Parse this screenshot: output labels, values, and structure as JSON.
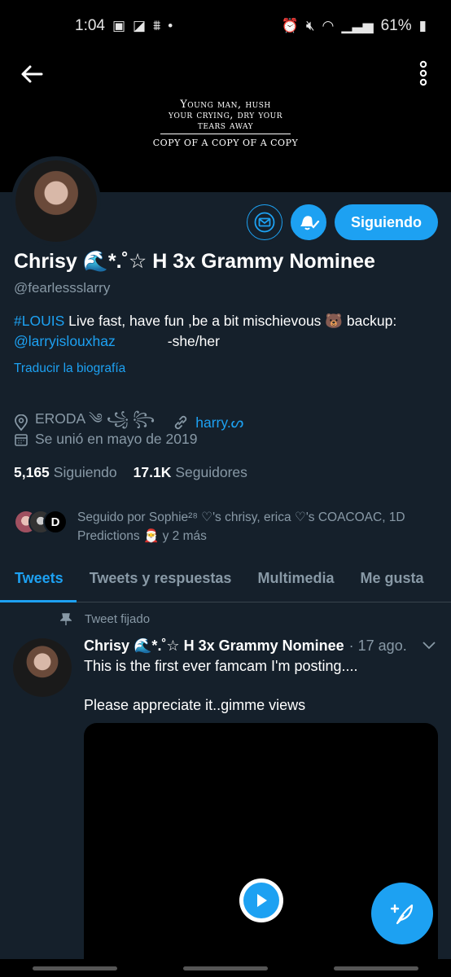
{
  "status_bar": {
    "time": "1:04",
    "battery": "61%"
  },
  "banner": {
    "lines": [
      "Young man, hush",
      "your crying, dry your",
      "tears away"
    ],
    "tagline": "COPY OF A COPY OF A COPY"
  },
  "profile": {
    "name": "Chrisy 🌊*.˚☆ H 3x Grammy Nominee",
    "handle": "@fearlessslarry",
    "bio_hashtag": "#LOUIS",
    "bio_text": " Live fast, have fun ,be a bit mischievous 🐻   backup:",
    "bio_mention": "@larryislouxhaz",
    "bio_pronouns": "-she/her",
    "translate": "Traducir la biografía",
    "location": "ERODA ༄ ꧁  ꧂",
    "link": "harry.ᔕ",
    "joined": "Se unió en mayo de 2019",
    "following_count": "5,165",
    "following_label": "Siguiendo",
    "followers_count": "17.1K",
    "followers_label": "Seguidores",
    "followed_by": "Seguido por Sophie²⁸ ♡'s chrisy, erica ♡'s COACOAC, 1D Predictions 🎅 y 2 más",
    "follow_button": "Siguiendo"
  },
  "tabs": [
    "Tweets",
    "Tweets y respuestas",
    "Multimedia",
    "Me gusta"
  ],
  "tweet": {
    "pinned_label": "Tweet fijado",
    "author": "Chrisy 🌊*.˚☆ H 3x Grammy Nominee",
    "date": "· 17 ago.",
    "line1": "This is the first ever famcam I'm posting....",
    "line2": "Please appreciate it..gimme views"
  },
  "colors": {
    "accent": "#1da1f2",
    "background": "#15202b",
    "muted": "#8899a6"
  }
}
